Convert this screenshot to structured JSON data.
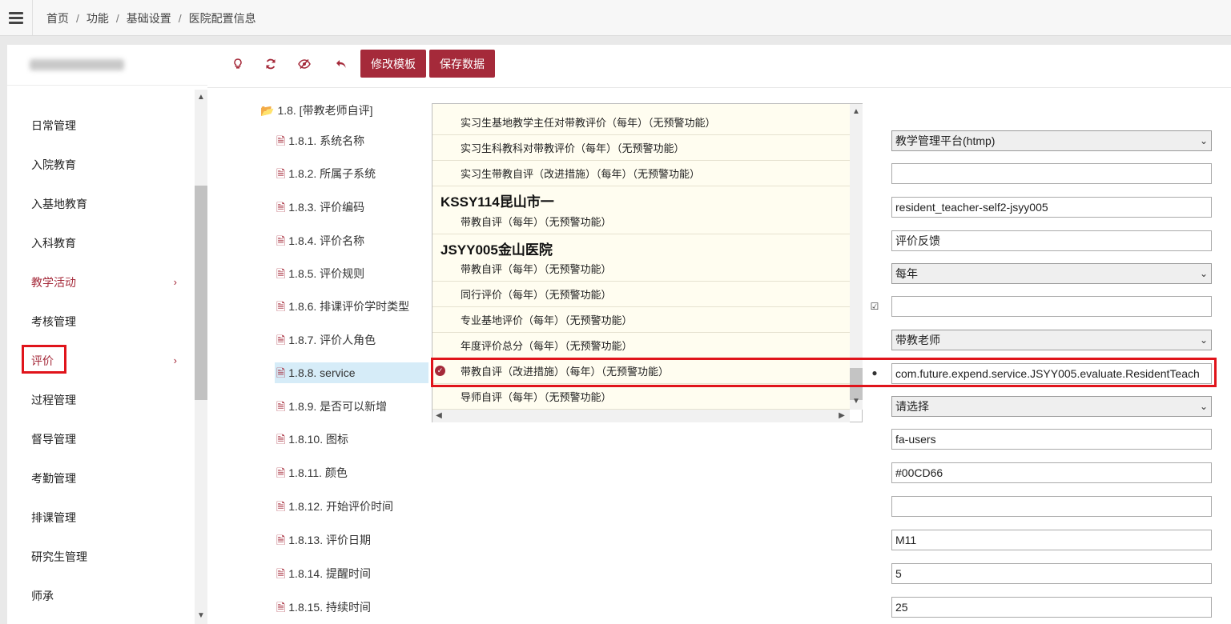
{
  "breadcrumb": [
    "首页",
    "功能",
    "基础设置",
    "医院配置信息"
  ],
  "sidebar": {
    "items": [
      {
        "label": "日常管理",
        "has_chevron": false
      },
      {
        "label": "入院教育",
        "has_chevron": false
      },
      {
        "label": "入基地教育",
        "has_chevron": false
      },
      {
        "label": "入科教育",
        "has_chevron": false
      },
      {
        "label": "教学活动",
        "has_chevron": true
      },
      {
        "label": "考核管理",
        "has_chevron": false
      },
      {
        "label": "评价",
        "has_chevron": true
      },
      {
        "label": "过程管理",
        "has_chevron": false
      },
      {
        "label": "督导管理",
        "has_chevron": false
      },
      {
        "label": "考勤管理",
        "has_chevron": false
      },
      {
        "label": "排课管理",
        "has_chevron": false
      },
      {
        "label": "研究生管理",
        "has_chevron": false
      },
      {
        "label": "师承",
        "has_chevron": false
      }
    ],
    "chevron": "›"
  },
  "toolbar": {
    "icons": [
      "bulb-icon",
      "refresh-icon",
      "eye-slash-icon",
      "undo-icon"
    ],
    "edit_template_label": "修改模板",
    "save_data_label": "保存数据"
  },
  "tree": {
    "folder_label": "1.8. [带教老师自评]",
    "nodes": [
      "1.8.1. 系统名称",
      "1.8.2. 所属子系统",
      "1.8.3. 评价编码",
      "1.8.4. 评价名称",
      "1.8.5. 评价规则",
      "1.8.6. 排课评价学时类型",
      "1.8.7. 评价人角色",
      "1.8.8. service",
      "1.8.9. 是否可以新增",
      "1.8.10. 图标",
      "1.8.11. 颜色",
      "1.8.12. 开始评价时间",
      "1.8.13. 评价日期",
      "1.8.14. 提醒时间",
      "1.8.15. 持续时间"
    ],
    "selected": "1.8.8. service"
  },
  "fields": {
    "system_name": "教学管理平台(htmp)",
    "subsystem": "",
    "eval_code": "resident_teacher-self2-jsyy005",
    "eval_name": "评价反馈",
    "eval_rule": "每年",
    "course_hour_type": "",
    "evaluator_role": "带教老师",
    "service": "com.future.expend.service.JSYY005.evaluate.ResidentTeach",
    "can_add": "请选择",
    "icon": "fa-users",
    "color": "#00CD66",
    "start_time": "",
    "eval_date": "M11",
    "remind_time": "5",
    "duration": "25"
  },
  "dropdown": {
    "options_top": [
      "实习生基地教学主任对带教评价（每年）（无预警功能）",
      "实习生科教科对带教评价（每年）（无预警功能）",
      "实习生带教自评（改进措施）（每年）（无预警功能）"
    ],
    "group_1": "KSSY114昆山市一",
    "group_1_options": [
      "带教自评（每年）（无预警功能）"
    ],
    "group_2": "JSYY005金山医院",
    "group_2_options": [
      "带教自评（每年）（无预警功能）",
      "同行评价（每年）（无预警功能）",
      "专业基地评价（每年）（无预警功能）",
      "年度评价总分（每年）（无预警功能）",
      "带教自评（改进措施）（每年）（无预警功能）",
      "导师自评（每年）（无预警功能）"
    ],
    "selected": "带教自评（改进措施）（每年）（无预警功能）"
  }
}
